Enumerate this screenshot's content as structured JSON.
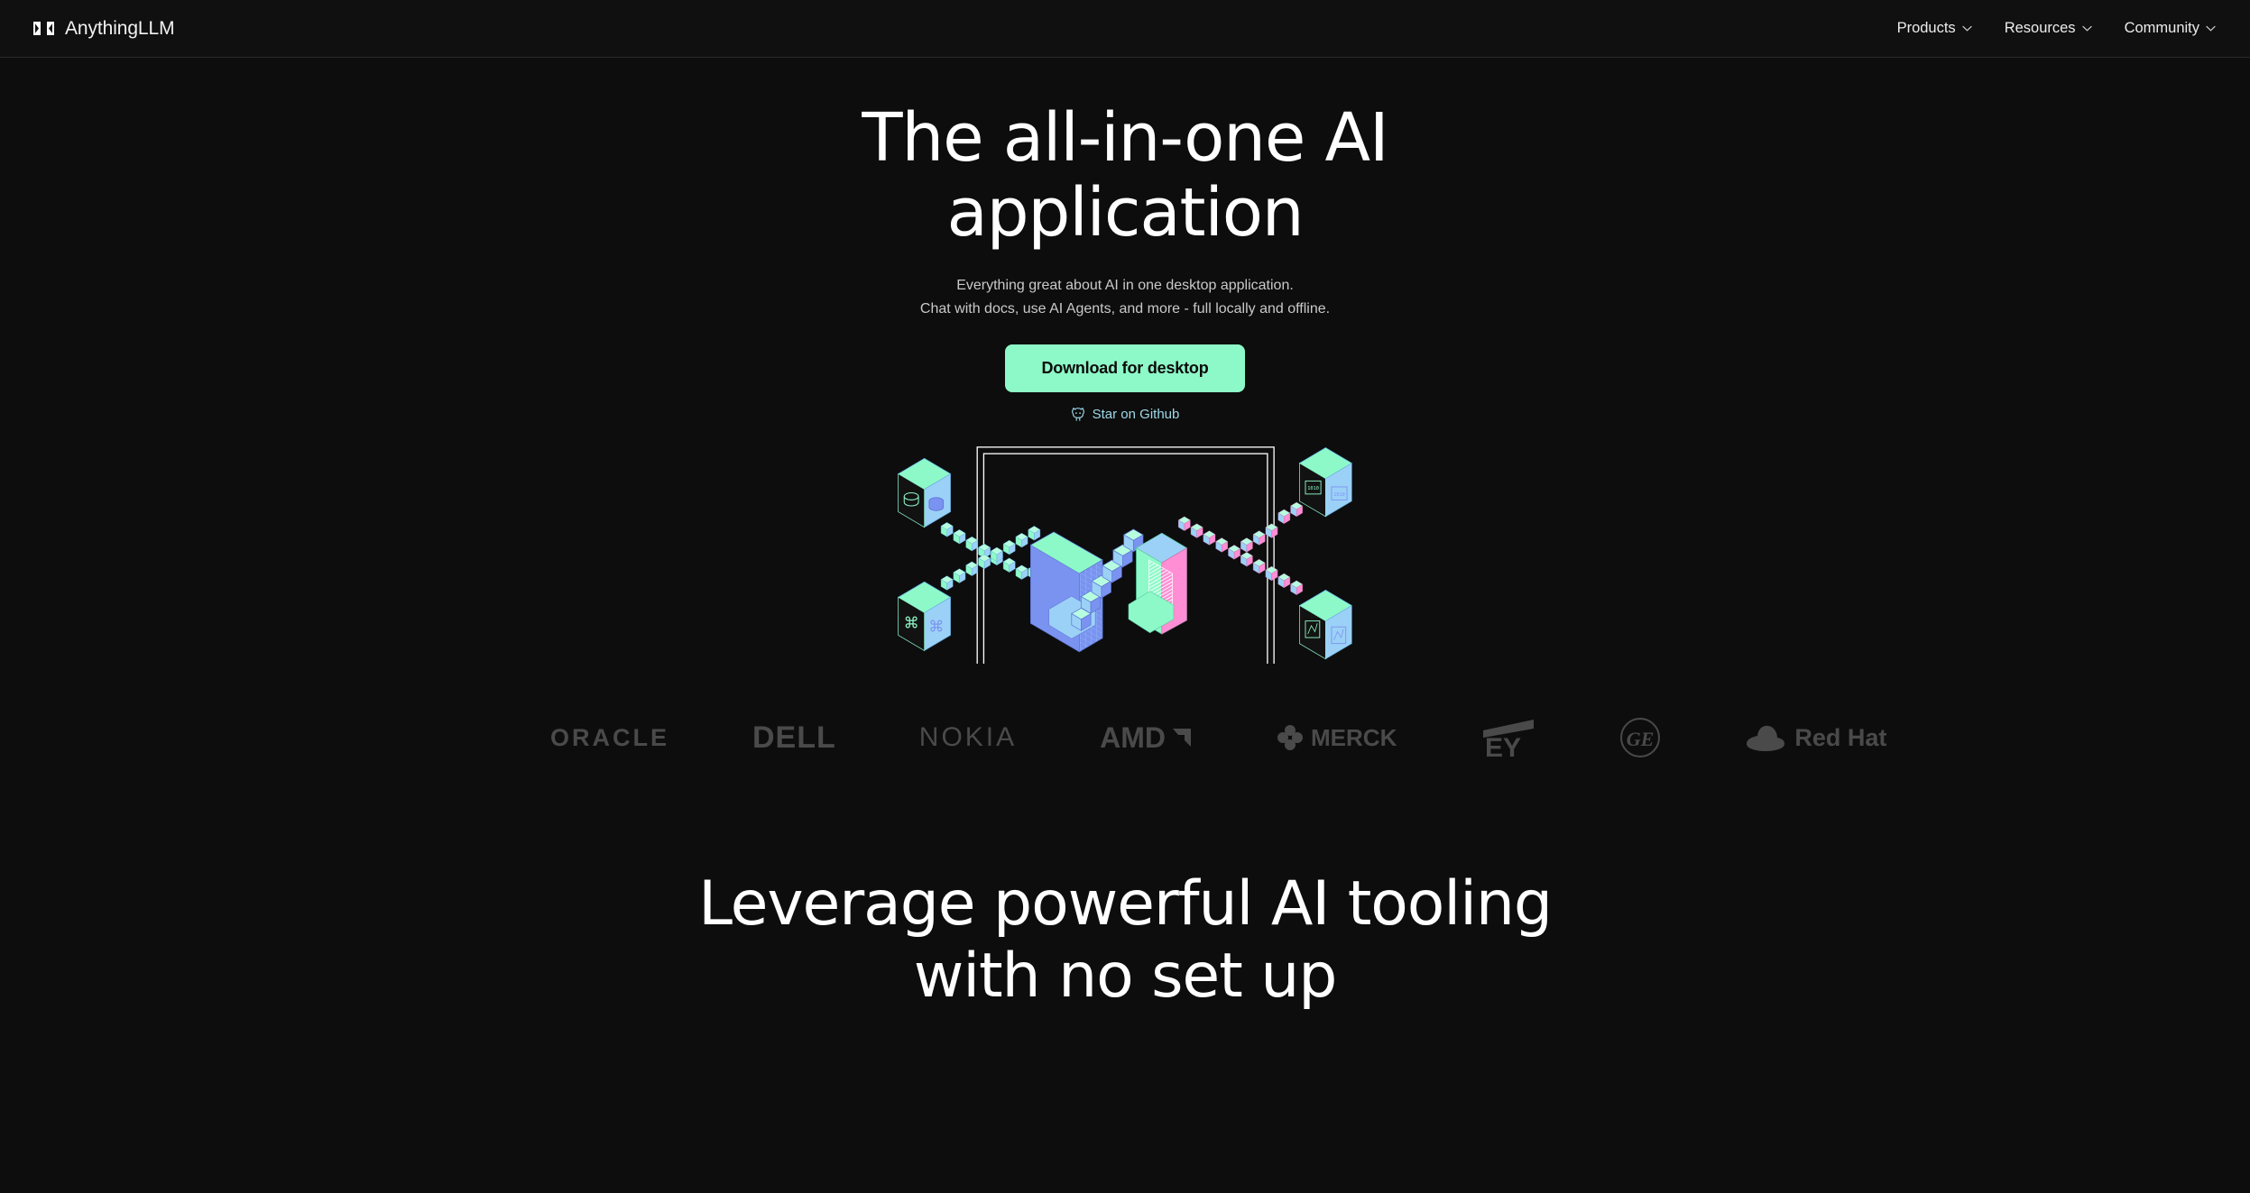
{
  "brand": {
    "name": "AnythingLLM",
    "logo_icon": "anythingllm-logo-mark"
  },
  "nav": {
    "items": [
      {
        "label": "Products",
        "icon": "chevron-down-icon"
      },
      {
        "label": "Resources",
        "icon": "chevron-down-icon"
      },
      {
        "label": "Community",
        "icon": "chevron-down-icon"
      }
    ]
  },
  "hero": {
    "title_line1": "The all-in-one AI",
    "title_line2": "application",
    "subtitle_line1": "Everything great about AI in one desktop application.",
    "subtitle_line2": "Chat with docs, use AI Agents, and more - full locally and offline.",
    "cta_label": "Download for desktop",
    "github_label": "Star on Github",
    "github_icon": "github-cat-icon"
  },
  "illustration": {
    "name": "isometric-laptop-network-illustration",
    "laptop_label": "laptop-outline",
    "center_shapes": [
      "blue-u-block",
      "cube-staircase",
      "pink-mint-u-block"
    ],
    "corner_nodes": [
      {
        "position": "top-left",
        "icon": "database-icon"
      },
      {
        "position": "bottom-left",
        "icon": "command-key-icon"
      },
      {
        "position": "top-right",
        "icon": "binary-code-icon"
      },
      {
        "position": "bottom-right",
        "icon": "document-chart-icon"
      }
    ],
    "colors": {
      "mint": "#8ef9c8",
      "sky": "#9cd1f7",
      "blue": "#7b93f0",
      "pink": "#ff8ed4",
      "outline": "#ffffff"
    }
  },
  "logos": {
    "items": [
      {
        "name": "oracle",
        "label": "ORACLE"
      },
      {
        "name": "dell",
        "label": "DELL"
      },
      {
        "name": "nokia",
        "label": "NOKIA"
      },
      {
        "name": "amd",
        "label": "AMD"
      },
      {
        "name": "merck",
        "label": "MERCK"
      },
      {
        "name": "ey",
        "label": "EY"
      },
      {
        "name": "ge",
        "label": "GE"
      },
      {
        "name": "redhat",
        "label": "Red Hat"
      }
    ]
  },
  "section2": {
    "title_line1": "Leverage powerful AI tooling",
    "title_line2": "with no set up"
  },
  "theme": {
    "background": "#0d0d0d",
    "navbar_background": "#101010",
    "accent_mint": "#8ef9c8",
    "link_blue": "#9fd8e8",
    "text_primary": "#ffffff",
    "text_secondary": "#c9c9c9"
  }
}
